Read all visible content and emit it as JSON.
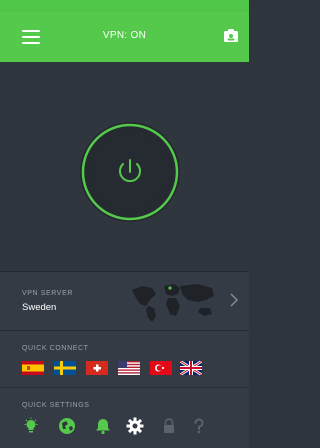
{
  "app_bar": {
    "title": "VPN: ON",
    "menu_icon": "hamburger-menu-icon",
    "account_icon": "account-card-icon"
  },
  "hero": {
    "power_icon": "power-icon",
    "accent_color": "#55c94c"
  },
  "server": {
    "label": "VPN SERVER",
    "name": "Sweden",
    "map_icon": "world-map-icon",
    "chevron_icon": "chevron-right-icon"
  },
  "quick_connect": {
    "label": "QUICK CONNECT",
    "flags": [
      {
        "country": "Spain",
        "icon": "spain-flag-icon"
      },
      {
        "country": "Sweden",
        "icon": "sweden-flag-icon"
      },
      {
        "country": "Switzerland",
        "icon": "switzerland-flag-icon"
      },
      {
        "country": "United States",
        "icon": "usa-flag-icon"
      },
      {
        "country": "Turkey",
        "icon": "turkey-flag-icon"
      },
      {
        "country": "United Kingdom",
        "icon": "uk-flag-icon"
      }
    ]
  },
  "quick_settings": {
    "label": "QUICK SETTINGS",
    "icons": [
      "lightbulb-icon",
      "globe-icon",
      "bell-icon",
      "gear-icon",
      "lock-icon",
      "help-icon"
    ]
  },
  "colors": {
    "brand_green": "#55c94c",
    "background": "#2f353d",
    "panel": "#353b44",
    "label_gray": "#9aa1aa"
  }
}
